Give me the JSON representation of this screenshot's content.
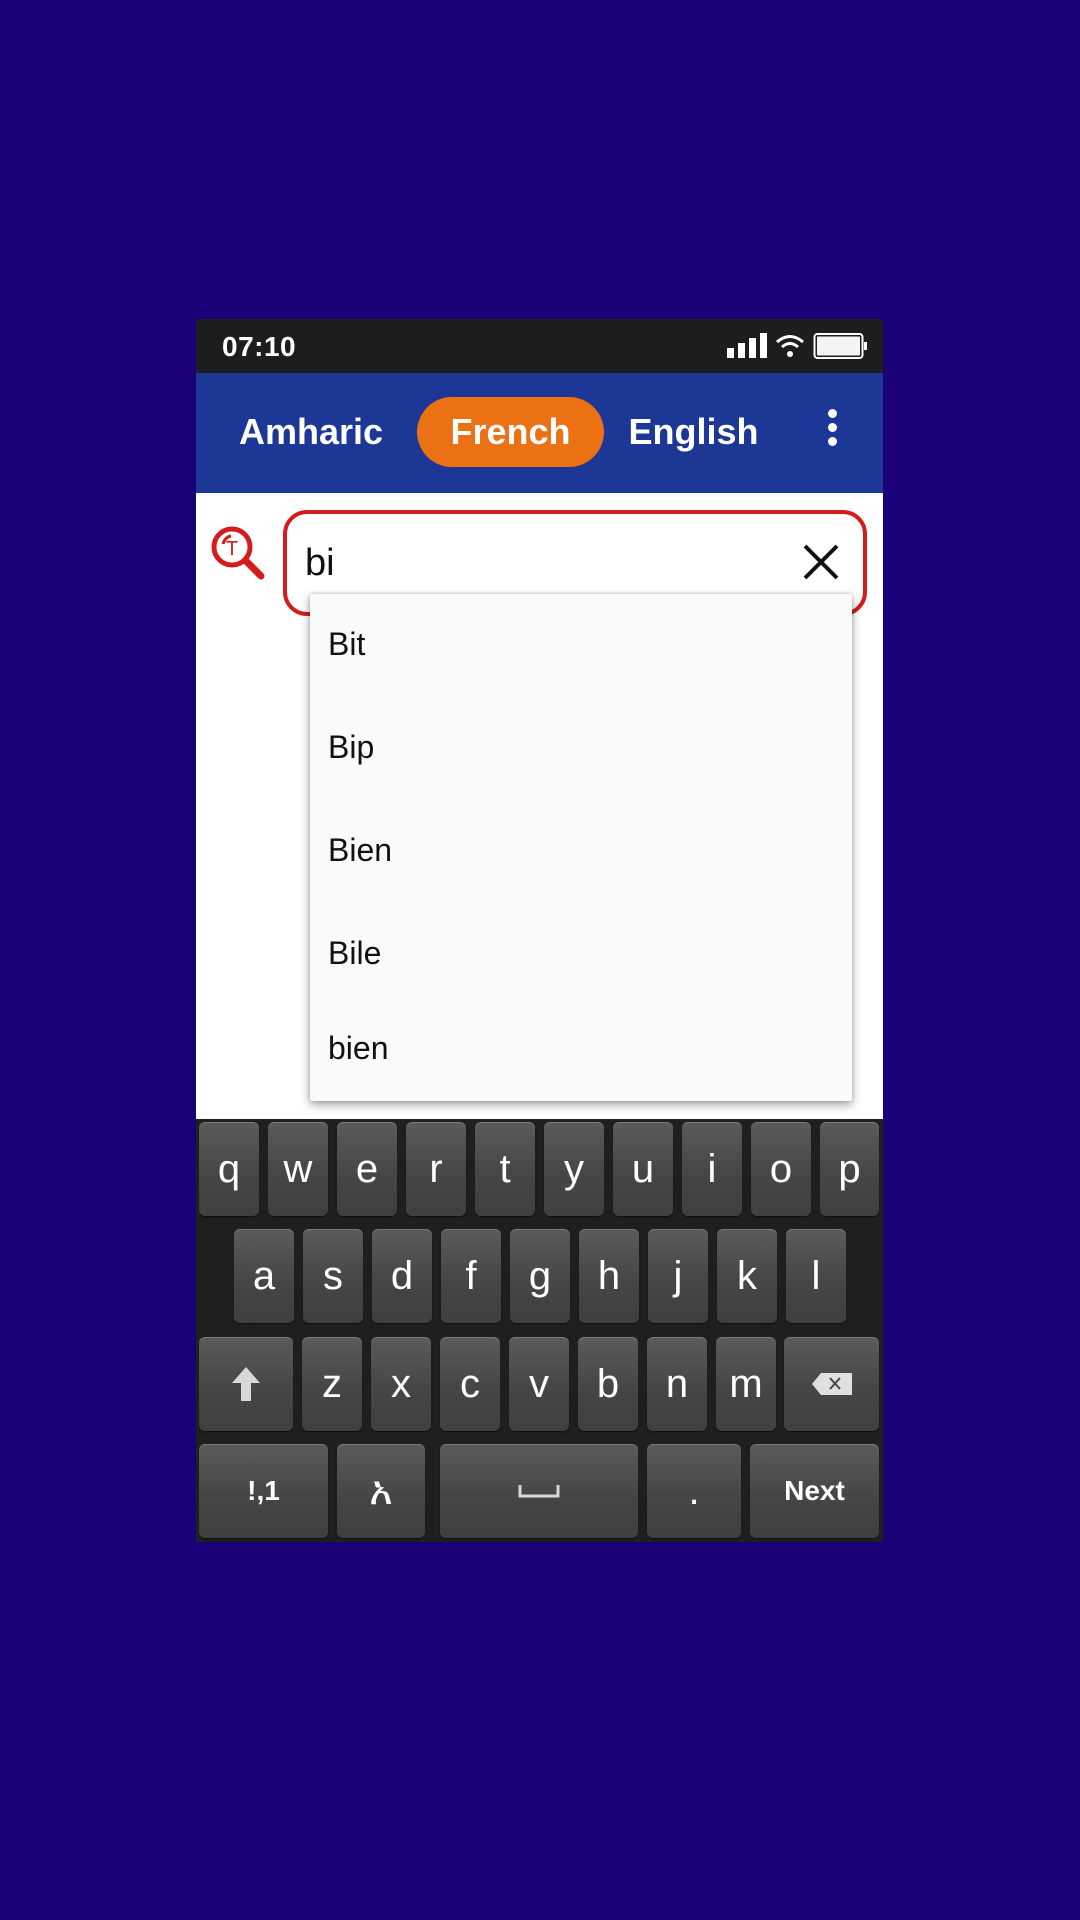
{
  "status_bar": {
    "time": "07:10",
    "icons": [
      "signal-icon",
      "wifi-icon",
      "battery-icon"
    ]
  },
  "header": {
    "tabs": [
      {
        "label": "Amharic",
        "active": false
      },
      {
        "label": "French",
        "active": true
      },
      {
        "label": "English",
        "active": false
      }
    ],
    "menu_icon": "more-vertical-icon",
    "colors": {
      "bar": "#1c3795",
      "active_tab": "#ec7014"
    }
  },
  "search": {
    "icon": "translate-search-icon",
    "value": "bi",
    "clear_icon": "close-icon",
    "border_color": "#d41c1c"
  },
  "suggestions": [
    "Bit",
    "Bip",
    "Bien",
    "Bile",
    "bien"
  ],
  "keyboard": {
    "row1": [
      "q",
      "w",
      "e",
      "r",
      "t",
      "y",
      "u",
      "i",
      "o",
      "p"
    ],
    "row2": [
      "a",
      "s",
      "d",
      "f",
      "g",
      "h",
      "j",
      "k",
      "l"
    ],
    "row3": [
      "z",
      "x",
      "c",
      "v",
      "b",
      "n",
      "m"
    ],
    "shift_icon": "shift-icon",
    "backspace_icon": "backspace-icon",
    "symbols_label": "!,1",
    "language_label": "አ",
    "space_icon": "space-icon",
    "period_label": ".",
    "next_label": "Next"
  }
}
